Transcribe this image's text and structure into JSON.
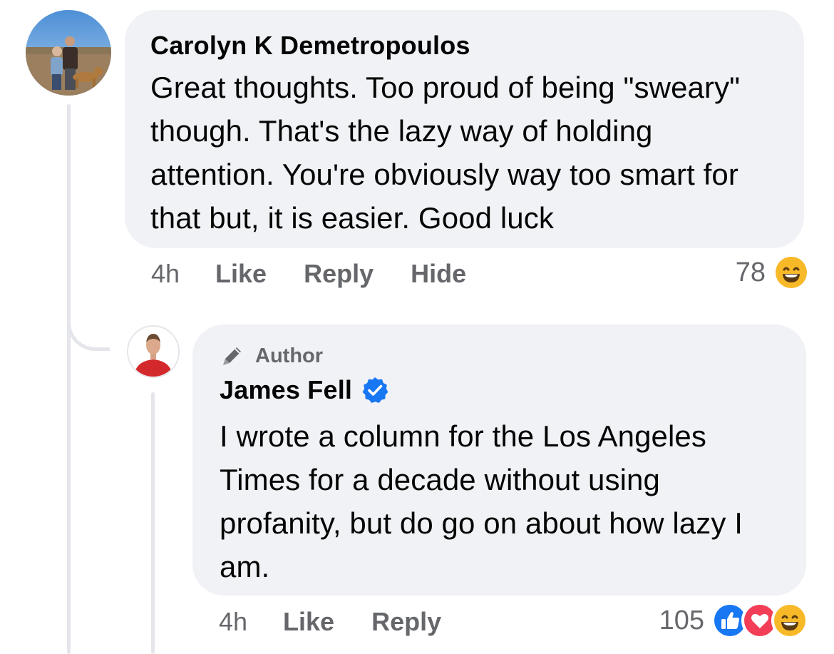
{
  "comments": [
    {
      "author": "Carolyn K Demetropoulos",
      "text": "Great thoughts. Too proud of being \"sweary\" though. That's the lazy way of holding attention. You're obviously way too smart for that but, it is easier. Good luck",
      "time": "4h",
      "actions": {
        "like": "Like",
        "reply": "Reply",
        "hide": "Hide"
      },
      "reaction_count": "78",
      "reaction_icons": [
        "haha-icon"
      ]
    },
    {
      "badge": "Author",
      "author": "James Fell",
      "verified": true,
      "text": "I wrote a column for the Los Angeles Times for a decade without using profanity, but do go on about how lazy I am.",
      "time": "4h",
      "actions": {
        "like": "Like",
        "reply": "Reply"
      },
      "reaction_count": "105",
      "reaction_icons": [
        "like-icon",
        "love-icon",
        "haha-icon"
      ]
    }
  ],
  "colors": {
    "bubble": "#f0f2f5",
    "meta_text": "#65676b",
    "like_blue": "#1877f2",
    "love_red": "#f33e58",
    "haha_yellow": "#f7b928",
    "thread_line": "#e4e6eb"
  }
}
